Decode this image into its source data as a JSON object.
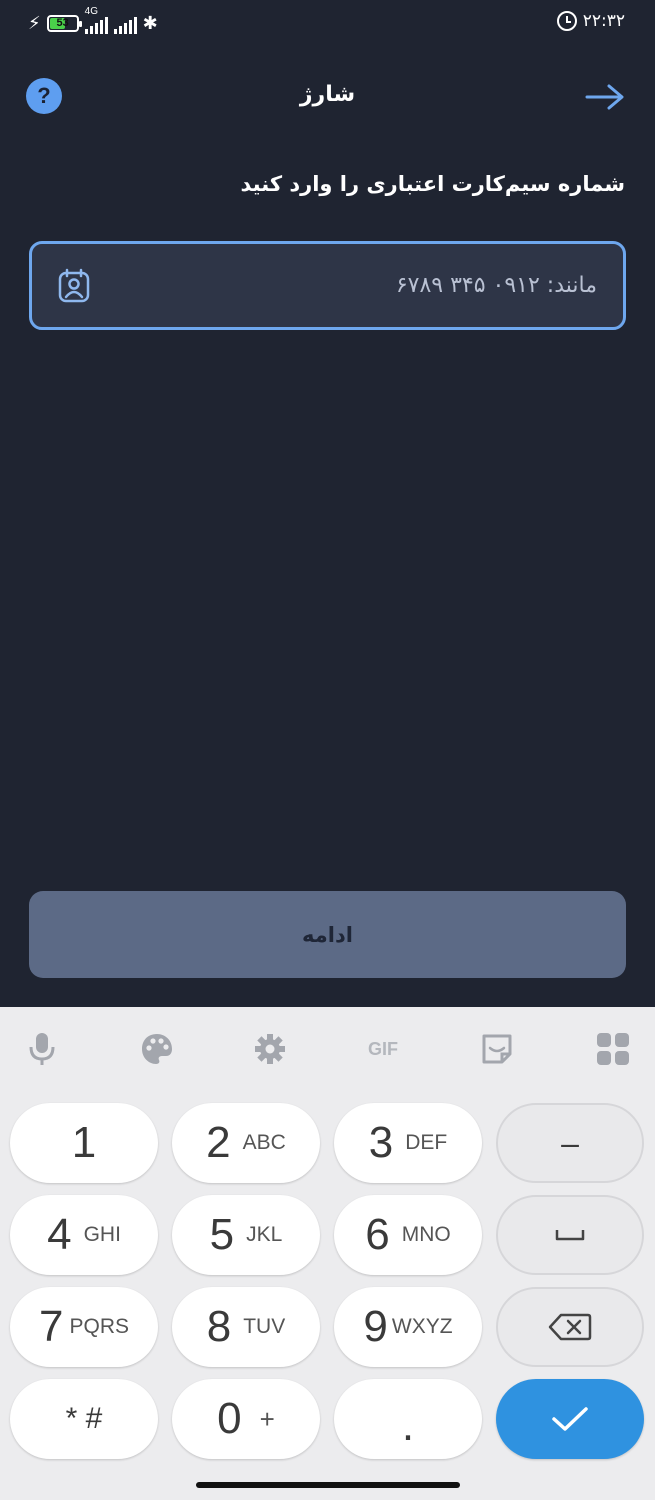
{
  "status_bar": {
    "battery": "53",
    "network": "4G",
    "time": "۲۲:۳۲"
  },
  "header": {
    "title": "شارژ",
    "help": "?"
  },
  "form": {
    "prompt": "شماره سیم‌کارت اعتباری را وارد کنید",
    "phone_placeholder": "مانند: ۰۹۱۲ ۳۴۵ ۶۷۸۹",
    "phone_value": ""
  },
  "actions": {
    "continue_label": "ادامه"
  },
  "keyboard": {
    "toolbar": {
      "gif": "GIF"
    },
    "keys": [
      {
        "num": "1",
        "sub": ""
      },
      {
        "num": "2",
        "sub": "ABC"
      },
      {
        "num": "3",
        "sub": "DEF"
      },
      {
        "num": "4",
        "sub": "GHI"
      },
      {
        "num": "5",
        "sub": "JKL"
      },
      {
        "num": "6",
        "sub": "MNO"
      },
      {
        "num": "7",
        "sub": "PQRS"
      },
      {
        "num": "8",
        "sub": "TUV"
      },
      {
        "num": "9",
        "sub": "WXYZ"
      },
      {
        "num": "* #",
        "sub": ""
      },
      {
        "num": "0",
        "sub": "+"
      },
      {
        "num": ".",
        "sub": ""
      }
    ],
    "minus": "–"
  },
  "colors": {
    "background": "#1f2431",
    "accent": "#5e9ef0",
    "button": "#5c6a86",
    "done_key": "#2f92e0"
  }
}
